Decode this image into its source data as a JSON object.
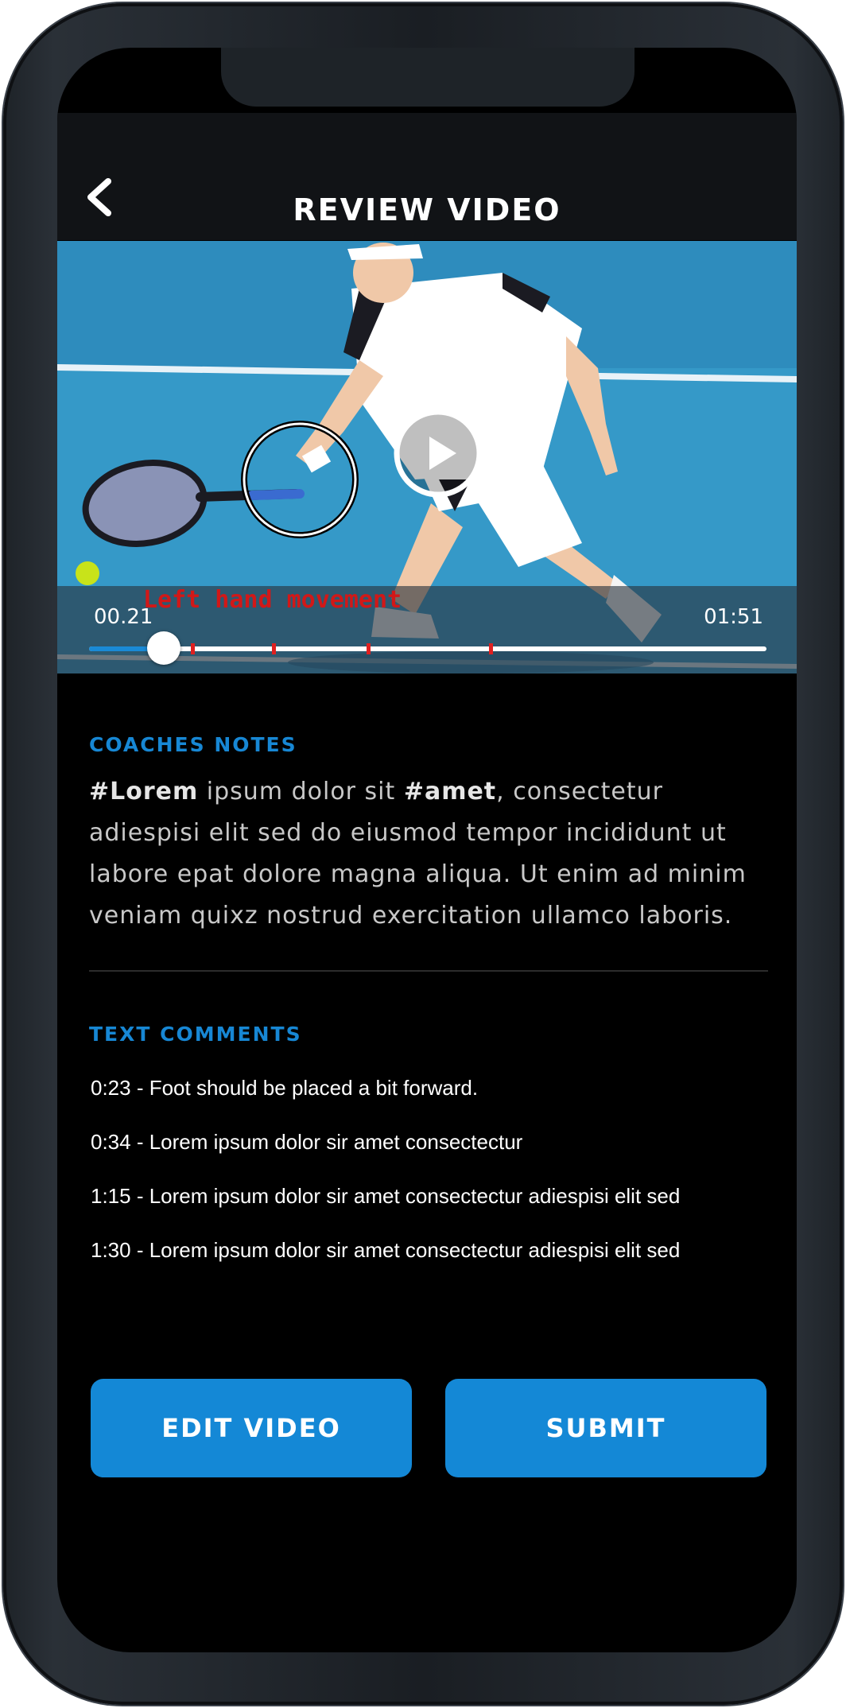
{
  "header": {
    "title": "REVIEW VIDEO",
    "back_icon": "chevron-left-icon"
  },
  "video": {
    "current_time": "00.21",
    "total_time": "01:51",
    "annotation_label": "Left hand movement",
    "progress": 0.11,
    "comment_markers": [
      0.15,
      0.27,
      0.41,
      0.59
    ],
    "play_icon": "play-icon",
    "accent_color": "#1488d6",
    "marker_color": "#e02020"
  },
  "coaches_notes": {
    "heading": "COACHES NOTES",
    "tag1": "#Lorem",
    "text1": " ipsum dolor sit ",
    "tag2": "#amet",
    "text2": ", consectetur adiespisi elit sed do eiusmod tempor incididunt ut labore epat dolore magna aliqua. Ut enim ad minim veniam quixz nostrud exercitation ullamco laboris."
  },
  "text_comments": {
    "heading": "TEXT COMMENTS",
    "items": [
      "0:23 - Foot should be placed a bit forward.",
      "0:34 - Lorem ipsum dolor sir amet consectectur",
      "1:15 - Lorem ipsum dolor sir amet consectectur adiespisi elit sed",
      "1:30 - Lorem ipsum dolor sir amet consectectur adiespisi elit sed"
    ]
  },
  "actions": {
    "edit_label": "EDIT VIDEO",
    "submit_label": "SUBMIT"
  },
  "colors": {
    "heading_blue": "#1787d4",
    "button_blue": "#1488d6",
    "background": "#000000"
  }
}
